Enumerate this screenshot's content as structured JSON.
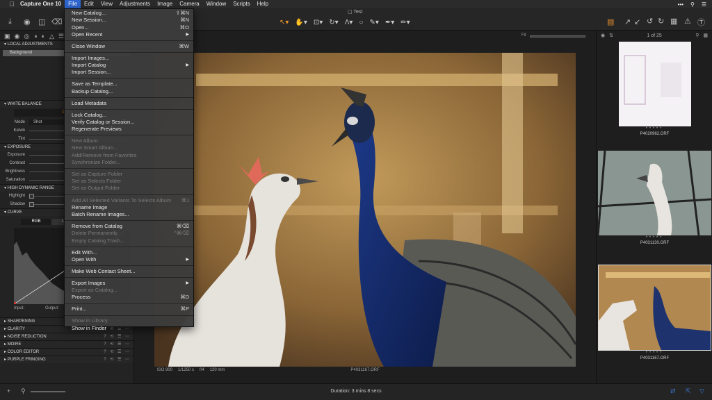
{
  "menubar": {
    "app_name": "Capture One 10",
    "items": [
      "File",
      "Edit",
      "View",
      "Adjustments",
      "Image",
      "Camera",
      "Window",
      "Scripts",
      "Help"
    ],
    "active": "File"
  },
  "window": {
    "title": "Test"
  },
  "file_menu": {
    "groups": [
      [
        {
          "label": "New Catalog...",
          "shortcut": "⇧⌘N"
        },
        {
          "label": "New Session...",
          "shortcut": "⌘N"
        },
        {
          "label": "Open...",
          "shortcut": "⌘O"
        },
        {
          "label": "Open Recent",
          "submenu": true
        }
      ],
      [
        {
          "label": "Close Window",
          "shortcut": "⌘W"
        }
      ],
      [
        {
          "label": "Import Images..."
        },
        {
          "label": "Import Catalog",
          "submenu": true
        },
        {
          "label": "Import Session..."
        }
      ],
      [
        {
          "label": "Save as Template..."
        },
        {
          "label": "Backup Catalog..."
        }
      ],
      [
        {
          "label": "Load Metadata"
        }
      ],
      [
        {
          "label": "Lock Catalog..."
        },
        {
          "label": "Verify Catalog or Session..."
        },
        {
          "label": "Regenerate Previews"
        }
      ],
      [
        {
          "label": "New Album",
          "disabled": true
        },
        {
          "label": "New Smart Album...",
          "disabled": true
        },
        {
          "label": "Add/Remove from Favorites",
          "disabled": true
        },
        {
          "label": "Synchronize Folder...",
          "disabled": true
        }
      ],
      [
        {
          "label": "Set as Capture Folder",
          "disabled": true
        },
        {
          "label": "Set as Selects Folder",
          "disabled": true
        },
        {
          "label": "Set as Output Folder",
          "disabled": true
        }
      ],
      [
        {
          "label": "Add All Selected Variants To Selects Album",
          "shortcut": "⌘J",
          "disabled": true
        },
        {
          "label": "Rename Image"
        },
        {
          "label": "Batch Rename Images..."
        }
      ],
      [
        {
          "label": "Remove from Catalog",
          "shortcut": "⌘⌫"
        },
        {
          "label": "Delete Permanently",
          "shortcut": "^⌘⌫",
          "disabled": true
        },
        {
          "label": "Empty Catalog Trash...",
          "disabled": true
        }
      ],
      [
        {
          "label": "Edit With..."
        },
        {
          "label": "Open With",
          "submenu": true
        }
      ],
      [
        {
          "label": "Make Web Contact Sheet..."
        }
      ],
      [
        {
          "label": "Export Images",
          "submenu": true
        },
        {
          "label": "Export as Catalog...",
          "disabled": true
        },
        {
          "label": "Process",
          "shortcut": "⌘D"
        }
      ],
      [
        {
          "label": "Print...",
          "shortcut": "⌘P"
        }
      ],
      [
        {
          "label": "Show in Library",
          "disabled": true
        },
        {
          "label": "Show in Finder"
        }
      ]
    ]
  },
  "left_panel": {
    "local_adjustments": "LOCAL ADJUSTMENTS",
    "layer_name": "Background",
    "white_balance": {
      "title": "WHITE BALANCE",
      "mode_button": "Grey",
      "props": [
        {
          "label": "Mode",
          "value": "Shot"
        },
        {
          "label": "Kelvin",
          "value": ""
        },
        {
          "label": "Tint",
          "value": ""
        }
      ]
    },
    "exposure": {
      "title": "EXPOSURE",
      "props": [
        "Exposure",
        "Contrast",
        "Brightness",
        "Saturation"
      ]
    },
    "hdr": {
      "title": "HIGH DYNAMIC RANGE",
      "props": [
        "Highlight",
        "Shadow"
      ]
    },
    "curve": {
      "title": "CURVE",
      "tabs": [
        "RGB",
        "Luma"
      ],
      "input_label": "Input:",
      "output_label": "Output:"
    },
    "collapsed_sections": [
      "SHARPENING",
      "CLARITY",
      "NOISE REDUCTION",
      "MOIRE",
      "COLOR EDITOR",
      "PURPLE FRINGING"
    ]
  },
  "viewer": {
    "fit_label": "Fit",
    "filename": "P4031167.ORF",
    "exif": {
      "iso": "ISO 800",
      "shutter": "1/1250 s",
      "aperture": "f/4",
      "focal": "120 mm"
    }
  },
  "browser": {
    "count": "1 of 25",
    "thumbnails": [
      {
        "name": "P4020962.ORF"
      },
      {
        "name": "P4031130.ORF"
      },
      {
        "name": "P4031167.ORF",
        "selected": true
      }
    ]
  },
  "bottom": {
    "duration": "Duration: 3 mins 8 secs"
  },
  "colors": {
    "accent": "#e8922c",
    "menu_highlight": "#2f66d0"
  }
}
